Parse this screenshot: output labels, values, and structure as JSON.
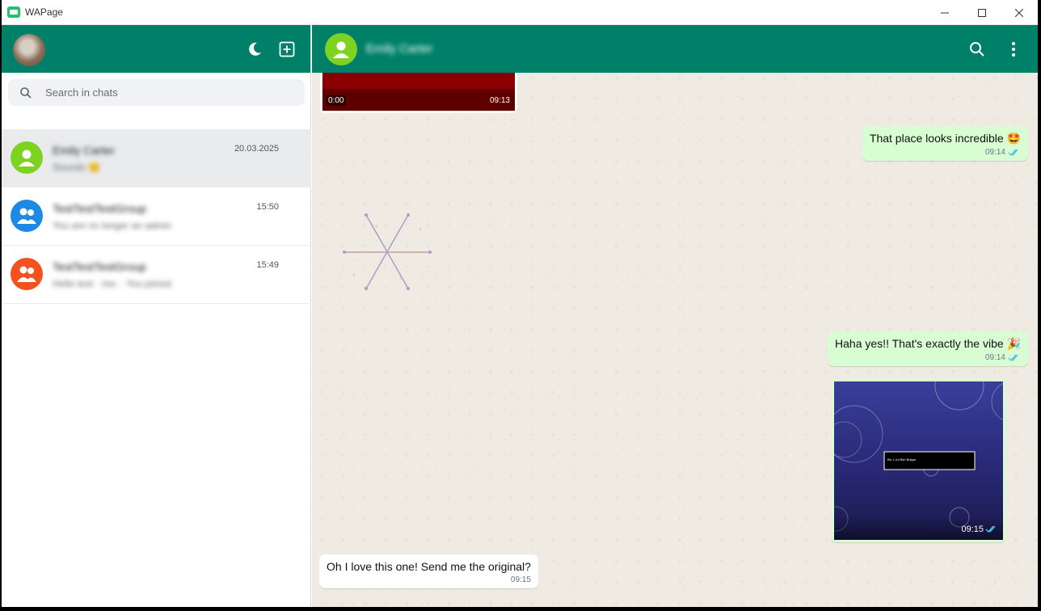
{
  "window": {
    "title": "WAPage",
    "minimize": "—",
    "maximize": "☐",
    "close": "✕"
  },
  "sidebar": {
    "search_placeholder": "Search in chats",
    "chats": [
      {
        "name": "Emily Carter",
        "preview": "Sounds 😊",
        "time": "20.03.2025",
        "avatar_color": "#7ed321",
        "avatar_icon": "person-icon"
      },
      {
        "name": "TestTestTestGroup",
        "preview": "You are no longer an admin",
        "time": "15:50",
        "avatar_color": "#1e88e5",
        "avatar_icon": "group-icon"
      },
      {
        "name": "TestTestTestGroup",
        "preview": "Hello test · me: · You joined",
        "time": "15:49",
        "avatar_color": "#f4511e",
        "avatar_icon": "group-icon"
      }
    ]
  },
  "chat": {
    "contact_name": "Emily Carter",
    "contact_avatar_color": "#7ed321",
    "video": {
      "position": "0:00",
      "time": "09:13"
    },
    "messages": [
      {
        "direction": "out",
        "text": "That place looks incredible 🤩",
        "time": "09:14",
        "status": "read"
      },
      {
        "direction": "out",
        "text": "Haha yes!! That's exactly the vibe 🎉",
        "time": "09:14",
        "status": "read"
      },
      {
        "direction": "in",
        "text": "Oh I love this one! Send me the original?",
        "time": "09:15"
      }
    ],
    "image_message": {
      "time": "09:15",
      "status": "read",
      "caption_box_text": "Ba 1 Jul Bsh Bulgar"
    }
  },
  "colors": {
    "brand": "#008069",
    "outgoing_bubble": "#d9fdd3",
    "read_ticks": "#53bdeb",
    "chat_bg": "#efeae2"
  }
}
